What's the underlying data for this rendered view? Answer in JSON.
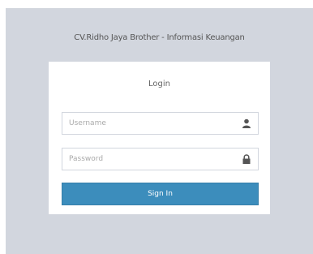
{
  "app": {
    "title": "CV.Ridho Jaya Brother - Informasi Keuangan"
  },
  "login": {
    "title": "Login",
    "username": {
      "placeholder": "Username",
      "value": "",
      "icon": "user-icon"
    },
    "password": {
      "placeholder": "Password",
      "value": "",
      "icon": "lock-icon"
    },
    "submit_label": "Sign In"
  },
  "colors": {
    "background": "#d2d6de",
    "card": "#ffffff",
    "primary": "#3c8dbc"
  }
}
